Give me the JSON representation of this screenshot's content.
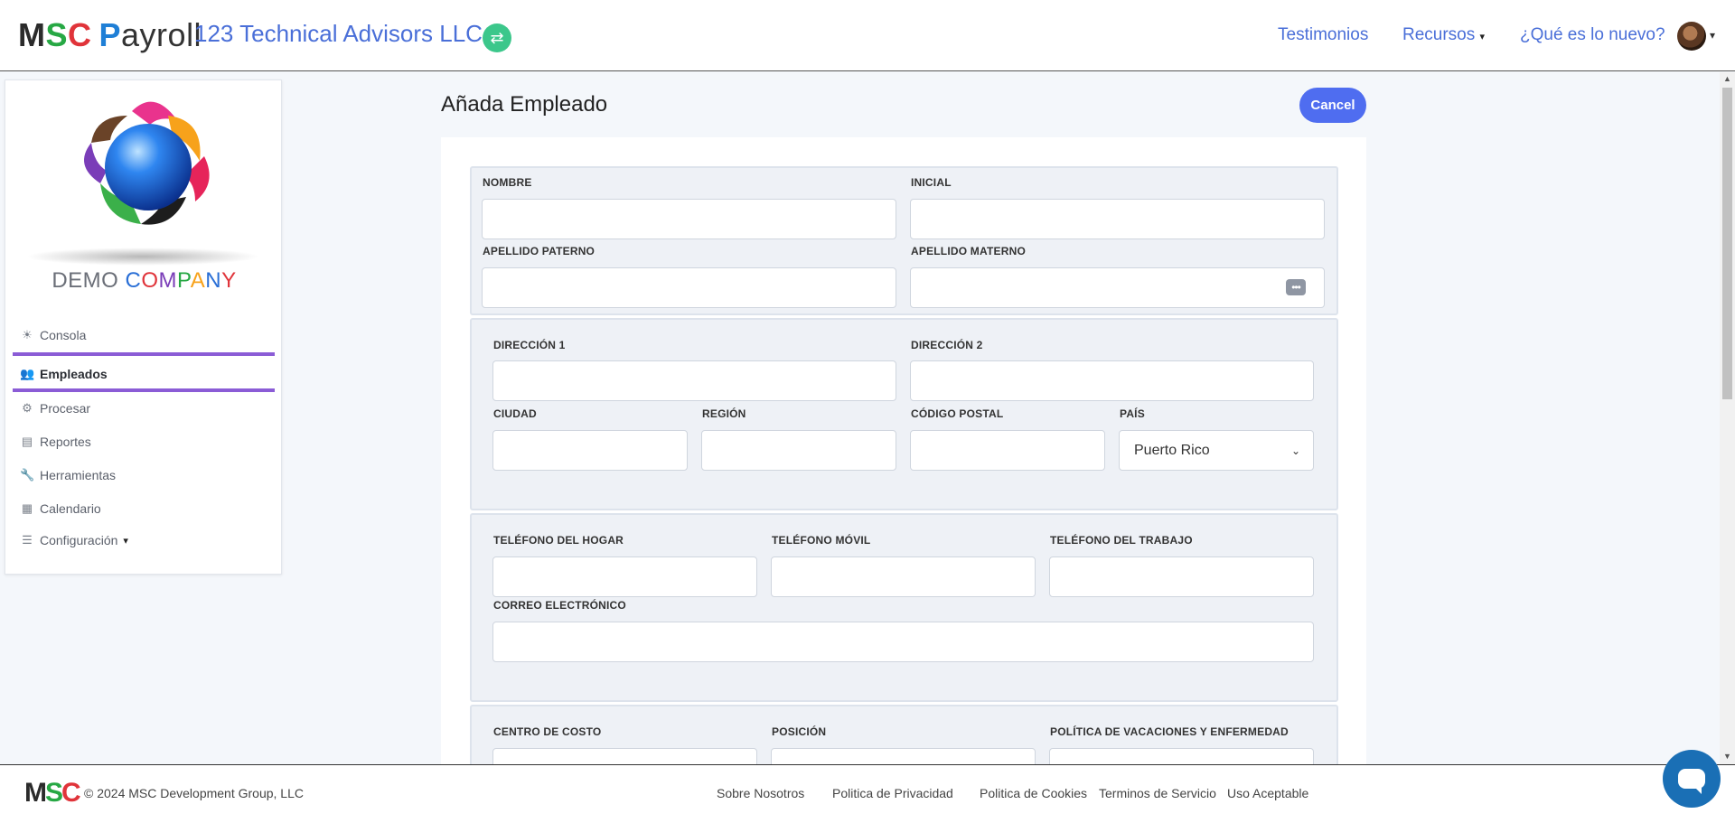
{
  "header": {
    "brand": {
      "m": "M",
      "s": "S",
      "c": "C",
      "p": "P",
      "rest": "ayroll"
    },
    "company": "123 Technical Advisors LLC",
    "nav": [
      "Testimonios",
      "Recursos",
      "¿Qué es lo nuevo?"
    ]
  },
  "sidebar": {
    "company_logo_text": {
      "demo": "DEMO",
      "company_letters": [
        "C",
        "O",
        "M",
        "P",
        "A",
        "N",
        "Y"
      ]
    },
    "items": [
      {
        "label": "Consola",
        "icon": "dashboard-icon"
      },
      {
        "label": "Empleados",
        "icon": "users-icon"
      },
      {
        "label": "Procesar",
        "icon": "gears-icon"
      },
      {
        "label": "Reportes",
        "icon": "printer-icon"
      },
      {
        "label": "Herramientas",
        "icon": "wrench-icon"
      },
      {
        "label": "Calendario",
        "icon": "calendar-icon"
      },
      {
        "label": "Configuración",
        "icon": "sliders-icon"
      }
    ],
    "active": "Empleados"
  },
  "main": {
    "title": "Añada Empleado",
    "cancel_label": "Cancel",
    "labels": {
      "nombre": "NOMBRE",
      "inicial": "INICIAL",
      "apellido_paterno": "APELLIDO PATERNO",
      "apellido_materno": "APELLIDO MATERNO",
      "direccion1": "DIRECCIÓN 1",
      "direccion2": "DIRECCIÓN 2",
      "ciudad": "CIUDAD",
      "region": "REGIÓN",
      "codigo_postal": "CÓDIGO POSTAL",
      "pais": "PAÍS",
      "tel_hogar": "TELÉFONO DEL HOGAR",
      "tel_movil": "TELÉFONO MÓVIL",
      "tel_trabajo": "TELÉFONO DEL TRABAJO",
      "correo": "CORREO ELECTRÓNICO",
      "centro_costo": "CENTRO DE COSTO",
      "posicion": "POSICIÓN",
      "politica": "POLÍTICA DE VACACIONES Y ENFERMEDAD"
    },
    "values": {
      "pais": "Puerto Rico"
    }
  },
  "footer": {
    "copyright": "© 2024 MSC Development Group, LLC",
    "links": [
      "Sobre Nosotros",
      "Politica de Privacidad",
      "Politica de Cookies",
      "Terminos de Servicio",
      "Uso Aceptable"
    ]
  },
  "colors": {
    "accent": "#4f6df0",
    "active_nav": "#8b5cd6",
    "link": "#4a6fd8",
    "switch": "#3cc78b",
    "chat": "#1a6fb5"
  }
}
